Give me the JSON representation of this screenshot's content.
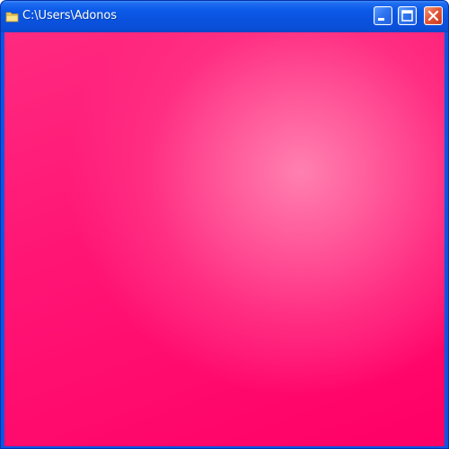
{
  "window": {
    "title": "C:\\Users\\Adonos",
    "icon": "folder-icon",
    "controls": {
      "minimize_icon": "minimize-icon",
      "maximize_icon": "maximize-icon",
      "close_icon": "close-icon"
    }
  },
  "colors": {
    "titlebar": "#0a55e3",
    "client_background": "#ff1474",
    "client_highlight": "#ff80b0",
    "close_button": "#e2593a"
  }
}
